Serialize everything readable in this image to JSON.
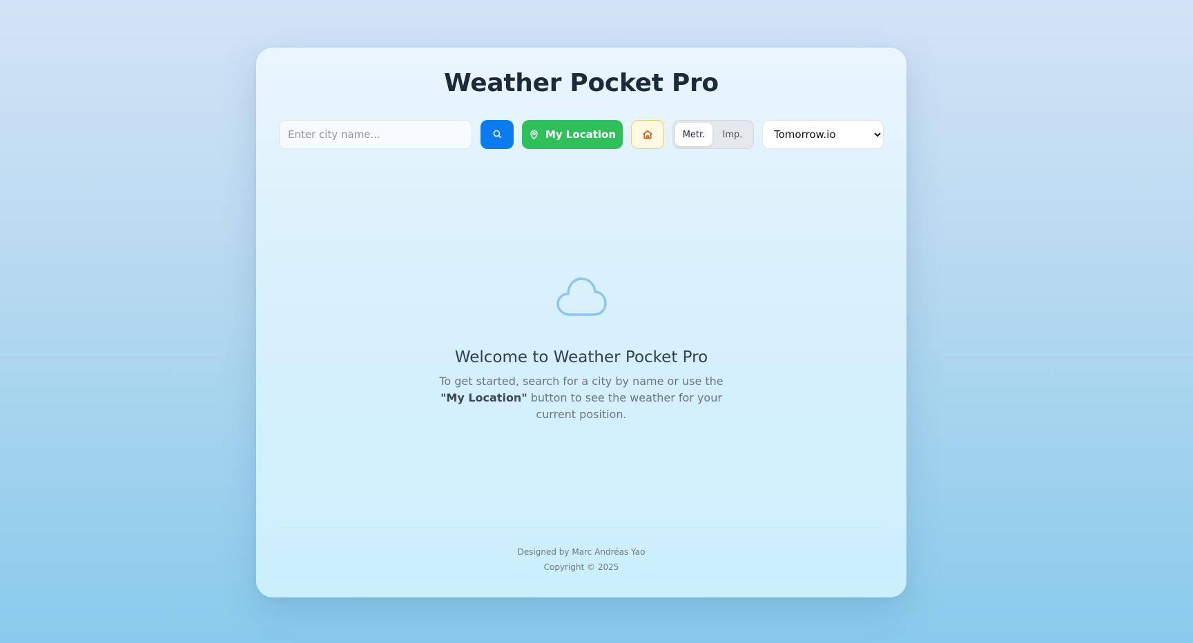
{
  "app": {
    "title": "Weather Pocket Pro"
  },
  "controls": {
    "search_placeholder": "Enter city name...",
    "search_icon": "search-icon",
    "my_location_label": "My Location",
    "location_icon": "map-pin-icon",
    "home_icon": "home-icon",
    "units": {
      "metric_label": "Metr.",
      "imperial_label": "Imp.",
      "selected": "metric"
    },
    "provider": {
      "selected": "Tomorrow.io",
      "options": [
        "Tomorrow.io"
      ]
    }
  },
  "welcome": {
    "icon": "cloud-icon",
    "heading": "Welcome to Weather Pocket Pro",
    "text_before": "To get started, search for a city by name or use the ",
    "text_bold": "\"My Location\"",
    "text_after": " button to see the weather for your current position."
  },
  "footer": {
    "designer": "Designed by Marc Andréas Yao",
    "copyright": "Copyright © 2025"
  },
  "colors": {
    "search_button": "#0d7bf0",
    "location_button": "#2fc05b",
    "home_button_bg": "#fff8e2",
    "home_icon": "#c8641a",
    "cloud_icon": "#90c4ee",
    "title": "#1c2b3a"
  }
}
